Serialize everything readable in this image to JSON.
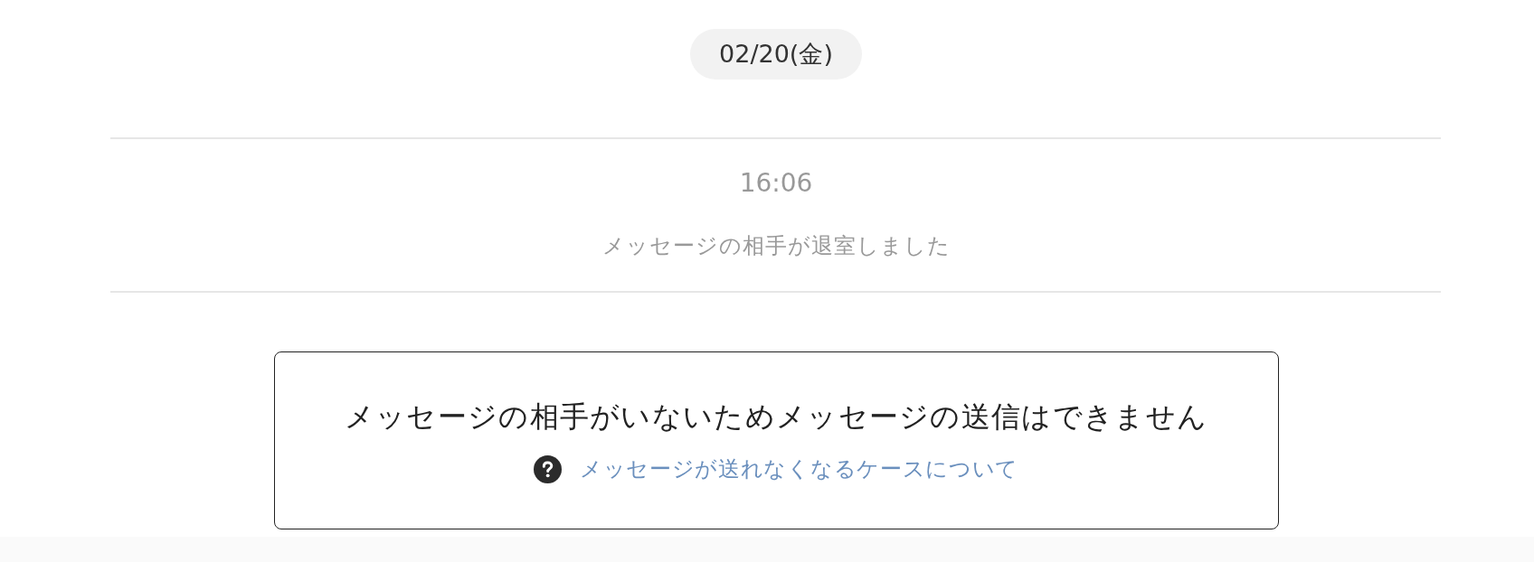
{
  "date_chip": {
    "label": "02/20(金)"
  },
  "system_event": {
    "time": "16:06",
    "message": "メッセージの相手が退室しました"
  },
  "notice": {
    "message": "メッセージの相手がいないためメッセージの送信はできません",
    "help_link": {
      "label": "メッセージが送れなくなるケースについて"
    }
  }
}
